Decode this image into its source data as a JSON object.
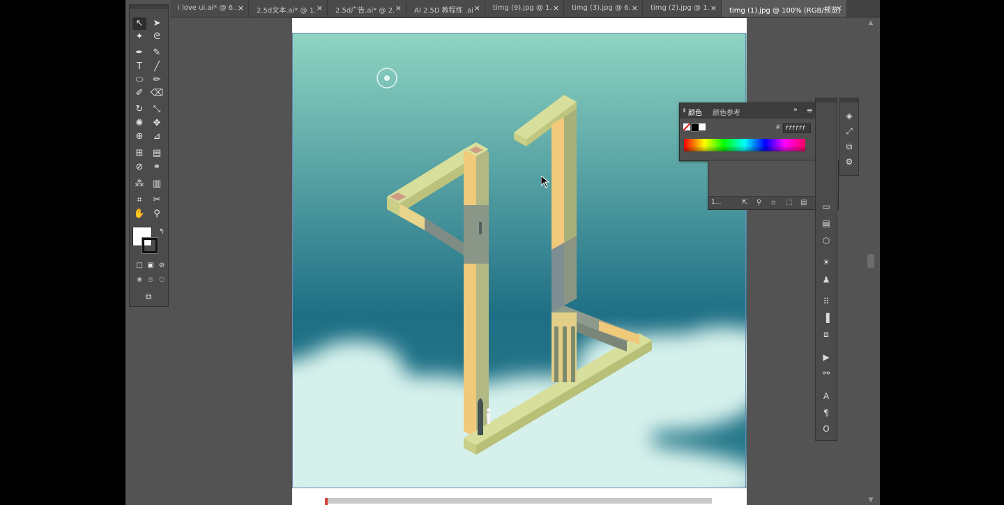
{
  "tabs": [
    {
      "label": "i love ui.ai* @ 6...",
      "close": "×"
    },
    {
      "label": "2.5d文本.ai* @ 1...",
      "close": "×"
    },
    {
      "label": "2.5d广告.ai* @ 2...",
      "close": "×"
    },
    {
      "label": "AI 2.5D 教程练 .ai",
      "close": "×"
    },
    {
      "label": "timg (9).jpg @ 1...",
      "close": "×"
    },
    {
      "label": "timg (3).jpg @ 6...",
      "close": "×"
    },
    {
      "label": "timg (2).jpg @ 1...",
      "close": "×"
    },
    {
      "label": "timg (1).jpg @ 100% (RGB/预览)",
      "close": "×"
    }
  ],
  "active_tab_index": 7,
  "tools": {
    "panel_menu_glyph": "»",
    "items": [
      {
        "name": "selection-tool-icon",
        "glyph": "↖"
      },
      {
        "name": "direct-selection-tool-icon",
        "glyph": "➤"
      },
      {
        "name": "magic-wand-tool-icon",
        "glyph": "✦"
      },
      {
        "name": "lasso-tool-icon",
        "glyph": "ᘓ"
      },
      {
        "name": "pen-tool-icon",
        "glyph": "✒"
      },
      {
        "name": "curvature-tool-icon",
        "glyph": "✎"
      },
      {
        "name": "type-tool-icon",
        "glyph": "T"
      },
      {
        "name": "line-tool-icon",
        "glyph": "╱"
      },
      {
        "name": "ellipse-tool-icon",
        "glyph": "⬭"
      },
      {
        "name": "paintbrush-tool-icon",
        "glyph": "✏"
      },
      {
        "name": "shaper-tool-icon",
        "glyph": "✐"
      },
      {
        "name": "eraser-tool-icon",
        "glyph": "⌫"
      },
      {
        "name": "rotate-tool-icon",
        "glyph": "↻"
      },
      {
        "name": "scale-tool-icon",
        "glyph": "⤡"
      },
      {
        "name": "warp-tool-icon",
        "glyph": "✺"
      },
      {
        "name": "free-transform-tool-icon",
        "glyph": "✥"
      },
      {
        "name": "shape-builder-tool-icon",
        "glyph": "⊕"
      },
      {
        "name": "perspective-grid-tool-icon",
        "glyph": "⊿"
      },
      {
        "name": "mesh-tool-icon",
        "glyph": "⊞"
      },
      {
        "name": "gradient-tool-icon",
        "glyph": "▤"
      },
      {
        "name": "eyedropper-tool-icon",
        "glyph": "⊘"
      },
      {
        "name": "blend-tool-icon",
        "glyph": "⚭"
      },
      {
        "name": "symbol-sprayer-tool-icon",
        "glyph": "⁂"
      },
      {
        "name": "column-graph-tool-icon",
        "glyph": "▥"
      },
      {
        "name": "artboard-tool-icon",
        "glyph": "⌗"
      },
      {
        "name": "slice-tool-icon",
        "glyph": "✂"
      },
      {
        "name": "hand-tool-icon",
        "glyph": "✋"
      },
      {
        "name": "zoom-tool-icon",
        "glyph": "⚲"
      }
    ],
    "fill_color": "#ffffff",
    "stroke_color": "#111111",
    "swap_glyph": "↰",
    "mode_icons": [
      "□",
      "▣",
      "⊘"
    ],
    "draw_mode_icons": [
      "◉",
      "◎",
      "○"
    ],
    "screen_mode_glyph": "⧉"
  },
  "color_panel": {
    "tabs": [
      "颜色",
      "颜色参考"
    ],
    "menu_glyph": "≡",
    "collapse_glyph": "»",
    "hex_prefix": "#",
    "hex_value": "ffffff",
    "fill_swatch": "#000000",
    "stroke_swatch": "#ffffff"
  },
  "layers_panel": {
    "count_label": "1...",
    "footer_icons": [
      "⇱",
      "⚲",
      "▫",
      "⬚",
      "▤",
      "🗑"
    ]
  },
  "dock_icons": {
    "narrow": [
      "▭",
      "▤",
      "⬡",
      "☀",
      "♟",
      "⠿",
      "▐",
      "⧈",
      "▶",
      "⚯",
      "A",
      "¶",
      "O"
    ],
    "wide": [
      "◈",
      "⤢",
      "⧉",
      "⚙"
    ]
  },
  "colors": {
    "workspace_bg": "#535353",
    "panel_bg": "#4b4b4b",
    "sky_top": "#8fd4c2",
    "sky_bottom": "#1e6f85",
    "cloud": "#d6f1ec",
    "beam_top": "#d8df9c",
    "beam_light": "#f1c97a",
    "beam_dark": "#8a9788"
  }
}
